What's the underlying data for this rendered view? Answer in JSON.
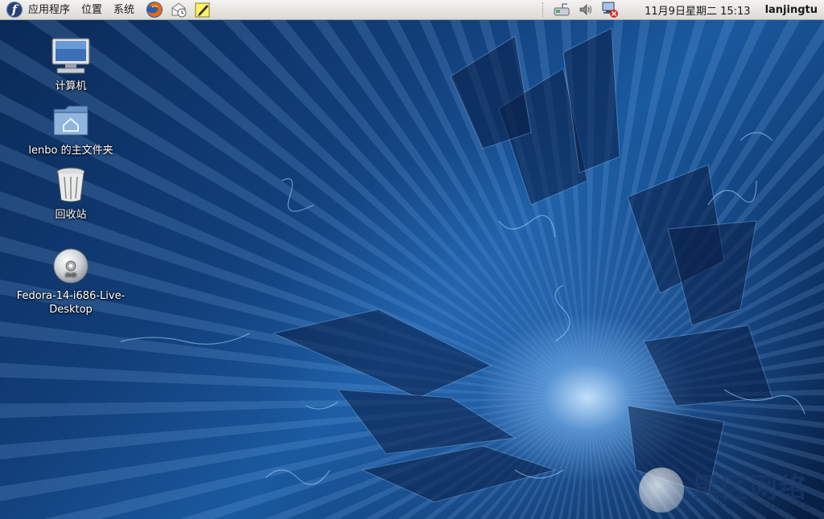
{
  "panel": {
    "menus": [
      "应用程序",
      "位置",
      "系统"
    ],
    "launchers": [
      "firefox-icon",
      "mail-icon",
      "notes-icon"
    ],
    "tray": [
      "network-wired-icon",
      "volume-icon",
      "network-disconnected-icon"
    ],
    "clock": "11月9日星期二 15:13",
    "username": "lanjingtu"
  },
  "desktop": {
    "icons": [
      {
        "name": "computer-icon",
        "label": "计算机"
      },
      {
        "name": "home-folder-icon",
        "label": "lenbo 的主文件夹"
      },
      {
        "name": "trash-icon",
        "label": "回收站"
      },
      {
        "name": "dvd-icon",
        "label": "Fedora-14-i686-Live-Desktop"
      }
    ]
  },
  "watermark": {
    "title": "黑区网络",
    "site": "www.heiqu.com"
  },
  "colors": {
    "panel_top": "#f4f3f1",
    "panel_bottom": "#dcdad5",
    "fedora_blue": "#294172",
    "wallpaper_dark": "#0a2a58",
    "wallpaper_light": "#1a5aa0"
  }
}
